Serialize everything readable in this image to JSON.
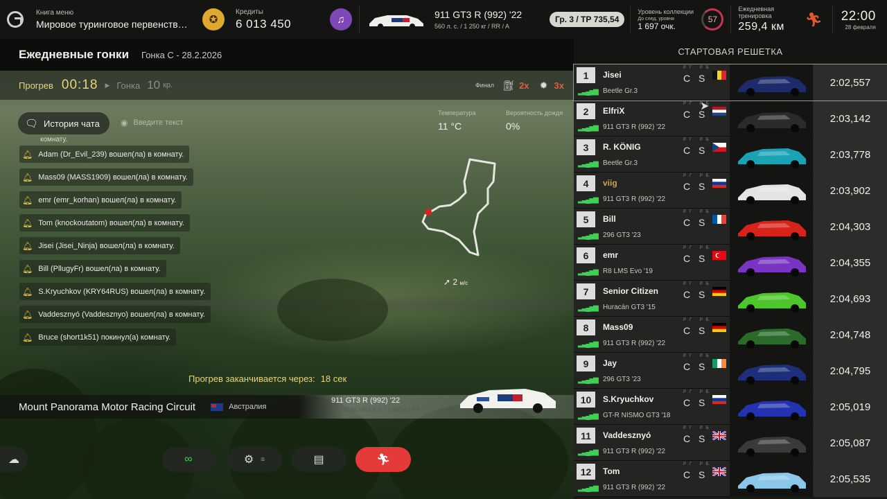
{
  "topbar": {
    "menu_book_label": "Книга меню",
    "menu_book_value": "Мировое туринговое первенств…",
    "credits_label": "Кредиты",
    "credits_value": "6 013 450",
    "car_name": "911 GT3 R (992) '22",
    "car_specs": "560 л. с. / 1 250 кг / RR / A",
    "tp_badge": "Гр. 3 / ТР 735,54",
    "collection_label": "Уровень коллекции",
    "collection_next_label": "До след. уровня",
    "collection_points": "1 697 очк.",
    "collection_level": "57",
    "daily_workout_label": "Ежедневная тренировка",
    "daily_workout_value": "259,4 км",
    "clock_time": "22:00",
    "clock_date": "28 февраля"
  },
  "header": {
    "title": "Ежедневные гонки",
    "race_subtitle": "Гонка С - 28.2.2026"
  },
  "warmup": {
    "label": "Прогрев",
    "timer": "00:18",
    "race_label": "Гонка",
    "laps": "10",
    "laps_unit": "кр.",
    "final_label": "Финал",
    "fuel_multiplier": "2x",
    "tyre_multiplier": "3x"
  },
  "chat": {
    "history_button": "История чата",
    "input_placeholder": "Введите текст",
    "cut_message": "комнату.",
    "messages": [
      "Adam (Dr_Evil_239) вошел(ла) в комнату.",
      "Mass09 (MASS1909) вошел(ла) в комнату.",
      "emr (emr_korhan) вошел(ла) в комнату.",
      "Tom (knockoutatom) вошел(ла) в комнату.",
      "Jisei (Jisei_Ninja) вошел(ла) в комнату.",
      "Bill (PllugyFr) вошел(ла) в комнату.",
      "S.Kryuchkov (KRY64RUS) вошел(ла) в комнату.",
      "Vaddesznyó (Vaddesznyo) вошел(ла) в комнату.",
      "Bruce (short1k51) покинул(а) комнату."
    ]
  },
  "weather": {
    "temp_label": "Температура",
    "temp_value": "11 °C",
    "rain_label": "Вероятность дождя",
    "rain_value": "0%",
    "wind_value": "2",
    "wind_unit": "м/с"
  },
  "footer": {
    "warmup_ends_label": "Прогрев заканчивается через:",
    "warmup_ends_value": "18 сек",
    "circuit_name": "Mount Panorama Motor Racing Circuit",
    "country": "Австралия",
    "car_name": "911 GT3 R (992) '22",
    "car_specs": "ТР 735,54 / 452 л. с. / 1 320 кг / RR"
  },
  "grid": {
    "title": "СТАРТОВАЯ РЕШЕТКА",
    "cs_label": "РГ РБ",
    "rows": [
      {
        "pos": "1",
        "name": "Jisei",
        "car": "Beetle Gr.3",
        "rating": "C S",
        "time": "2:02,557",
        "flag": "be",
        "color": "#1e2b6b",
        "me": false
      },
      {
        "pos": "2",
        "name": "ElfriX",
        "car": "911 GT3 R (992) '22",
        "rating": "C S",
        "time": "2:03,142",
        "flag": "nl",
        "color": "#2b2b2b",
        "me": false
      },
      {
        "pos": "3",
        "name": "R. KÖNIG",
        "car": "Beetle Gr.3",
        "rating": "C S",
        "time": "2:03,778",
        "flag": "cz",
        "color": "#1aa3b5",
        "me": false
      },
      {
        "pos": "4",
        "name": "viig",
        "car": "911 GT3 R (992) '22",
        "rating": "C S",
        "time": "2:03,902",
        "flag": "ru",
        "color": "#e4e4e4",
        "me": true
      },
      {
        "pos": "5",
        "name": "Bill",
        "car": "296 GT3 '23",
        "rating": "C S",
        "time": "2:04,303",
        "flag": "fr",
        "color": "#d8231b",
        "me": false
      },
      {
        "pos": "6",
        "name": "emr",
        "car": "R8 LMS Evo '19",
        "rating": "C S",
        "time": "2:04,355",
        "flag": "tr",
        "color": "#7a34c4",
        "me": false
      },
      {
        "pos": "7",
        "name": "Senior Citizen",
        "car": "Huracán GT3 '15",
        "rating": "C S",
        "time": "2:04,693",
        "flag": "de",
        "color": "#4cc62a",
        "me": false
      },
      {
        "pos": "8",
        "name": "Mass09",
        "car": "911 GT3 R (992) '22",
        "rating": "C S",
        "time": "2:04,748",
        "flag": "de",
        "color": "#2a6b2a",
        "me": false
      },
      {
        "pos": "9",
        "name": "Jay",
        "car": "296 GT3 '23",
        "rating": "C S",
        "time": "2:04,795",
        "flag": "ie",
        "color": "#1d2f7a",
        "me": false
      },
      {
        "pos": "10",
        "name": "S.Kryuchkov",
        "car": "GT-R NISMO GT3 '18",
        "rating": "C S",
        "time": "2:05,019",
        "flag": "ru",
        "color": "#2332b0",
        "me": false
      },
      {
        "pos": "11",
        "name": "Vaddesznyó",
        "car": "911 GT3 R (992) '22",
        "rating": "C S",
        "time": "2:05,087",
        "flag": "gb",
        "color": "#3a3a3a",
        "me": false
      },
      {
        "pos": "12",
        "name": "Tom",
        "car": "911 GT3 R (992) '22",
        "rating": "C S",
        "time": "2:05,535",
        "flag": "gb",
        "color": "#8ac7e8",
        "me": false
      }
    ]
  },
  "icons": {
    "gt_logo": "gt-logo-icon",
    "menu_book": "menu-book-icon",
    "car_collection": "garage-icon",
    "fuel": "fuel-icon",
    "tyre": "tyre-icon",
    "weather_button": "weather-icon",
    "link_button": "link-icon",
    "settings_button": "gear-icon",
    "notes_button": "notes-icon",
    "exit_button": "runner-icon"
  },
  "colors": {
    "accent_yellow": "#e8d67a",
    "accent_red": "#e53a3a",
    "multiplier_red": "#f0553b",
    "signal_green": "#3fcf55"
  }
}
